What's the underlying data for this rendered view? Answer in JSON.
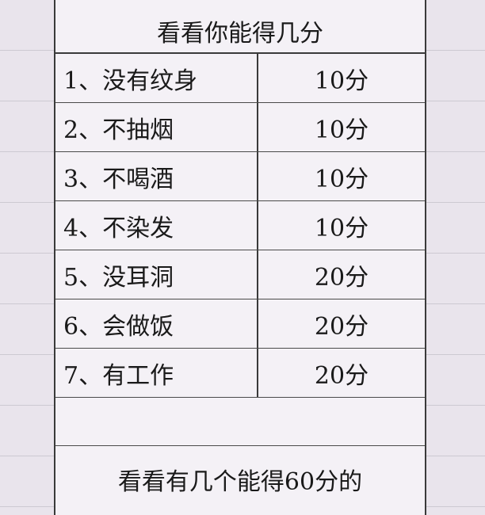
{
  "title": "看看你能得几分",
  "items": [
    {
      "label": "1、没有纹身",
      "score": "10分"
    },
    {
      "label": "2、不抽烟",
      "score": "10分"
    },
    {
      "label": "3、不喝酒",
      "score": "10分"
    },
    {
      "label": "4、不染发",
      "score": "10分"
    },
    {
      "label": "5、没耳洞",
      "score": "20分"
    },
    {
      "label": "6、会做饭",
      "score": "20分"
    },
    {
      "label": "7、有工作",
      "score": "20分"
    }
  ],
  "footer": "看看有几个能得60分的"
}
